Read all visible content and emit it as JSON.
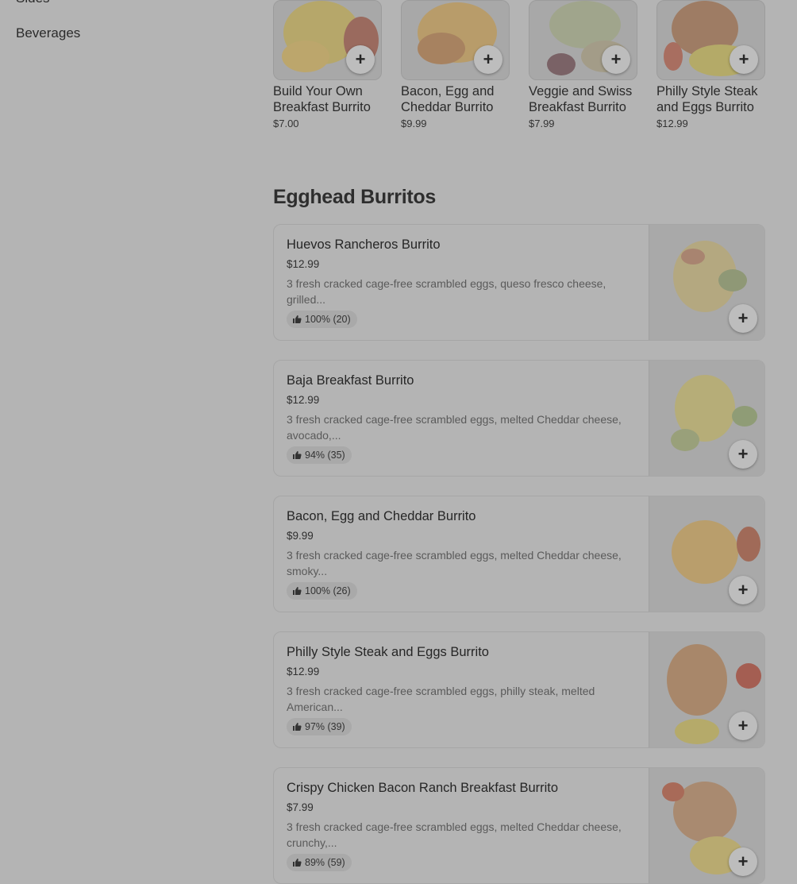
{
  "sidebar": {
    "items": [
      "Sides",
      "Beverages"
    ]
  },
  "featured": [
    {
      "name_line1": "Build Your Own",
      "name_line2": "Breakfast Burrito",
      "price": "$7.00"
    },
    {
      "name_line1": "Bacon, Egg and",
      "name_line2": "Cheddar Burrito",
      "price": "$9.99"
    },
    {
      "name_line1": "Veggie and Swiss",
      "name_line2": "Breakfast Burrito",
      "price": "$7.99"
    },
    {
      "name_line1": "Philly Style Steak",
      "name_line2": "and Eggs Burrito",
      "price": "$12.99"
    }
  ],
  "section": {
    "title": "Egghead Burritos",
    "items": [
      {
        "name": "Huevos Rancheros Burrito",
        "price": "$12.99",
        "desc_line1": "3 fresh cracked cage-free scrambled eggs, queso fresco cheese,",
        "desc_line2": "grilled...",
        "rating": "100% (20)"
      },
      {
        "name": "Baja Breakfast Burrito",
        "price": "$12.99",
        "desc_line1": "3 fresh cracked cage-free scrambled eggs, melted Cheddar cheese,",
        "desc_line2": "avocado,...",
        "rating": "94% (35)"
      },
      {
        "name": "Bacon, Egg and Cheddar Burrito",
        "price": "$9.99",
        "desc_line1": "3 fresh cracked cage-free scrambled eggs, melted Cheddar cheese,",
        "desc_line2": "smoky...",
        "rating": "100% (26)"
      },
      {
        "name": "Philly Style Steak and Eggs Burrito",
        "price": "$12.99",
        "desc_line1": "3 fresh cracked cage-free scrambled eggs, philly steak, melted",
        "desc_line2": "American...",
        "rating": "97% (39)"
      },
      {
        "name": "Crispy Chicken Bacon Ranch Breakfast Burrito",
        "price": "$7.99",
        "desc_line1": "3 fresh cracked cage-free scrambled eggs, melted Cheddar cheese,",
        "desc_line2": "crunchy,...",
        "rating": "89% (59)"
      }
    ]
  },
  "icons": {
    "add": "plus-icon",
    "rating": "thumbs-up-icon"
  },
  "add_symbol": "+"
}
